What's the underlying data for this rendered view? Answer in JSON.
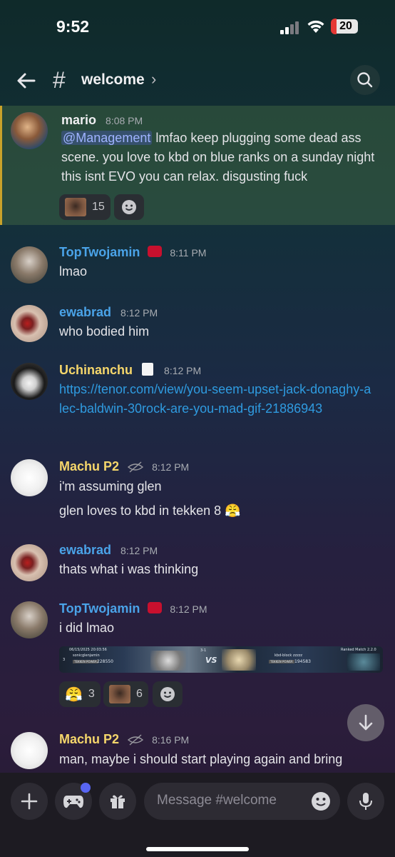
{
  "status": {
    "time": "9:52",
    "battery": "20"
  },
  "header": {
    "channel": "welcome",
    "chevron": "›"
  },
  "messages": [
    {
      "author": "mario",
      "time": "8:08 PM",
      "mention": "@Management",
      "text": " lmfao keep plugging some dead ass scene. you love to kbd on blue ranks on a sunday night this isnt EVO you can relax. disgusting fuck",
      "reaction_count": "15"
    },
    {
      "author": "TopTwojamin",
      "time": "8:11 PM",
      "text": "lmao"
    },
    {
      "author": "ewabrad",
      "time": "8:12 PM",
      "text": "who bodied him"
    },
    {
      "author": "Uchinanchu",
      "time": "8:12 PM",
      "text": "https://tenor.com/view/you-seem-upset-jack-donaghy-alec-baldwin-30rock-are-you-mad-gif-21886943"
    },
    {
      "author": "Machu P2",
      "time": "8:12 PM",
      "text": "i'm assuming glen",
      "text2": "glen loves to kbd in tekken 8 😤"
    },
    {
      "author": "ewabrad",
      "time": "8:12 PM",
      "text": "thats what i was thinking"
    },
    {
      "author": "TopTwojamin",
      "time": "8:12 PM",
      "text": "i did lmao",
      "reaction1_count": "3",
      "reaction2_count": "6",
      "embed": {
        "date": "06/15/2025 20:03:56",
        "p1": "sonicglenjamin",
        "p1_label": "TEKKEN POWER",
        "p1_power": "228550",
        "vs": "VS",
        "p2": "kbd-block zzzzz",
        "p2_label": "TEKKEN POWER",
        "p2_power": "194583",
        "mode": "Ranked Match",
        "version": "2.2.0",
        "score": "3-1",
        "row": "3"
      }
    },
    {
      "author": "Machu P2",
      "time": "8:16 PM",
      "text": "man, maybe i should start playing again and bring"
    }
  ],
  "composer": {
    "placeholder": "Message #welcome"
  },
  "colors": {
    "accent_blue": "#3b9be6",
    "gold": "#f5d66b",
    "highlight_bar": "#c9a22a"
  }
}
